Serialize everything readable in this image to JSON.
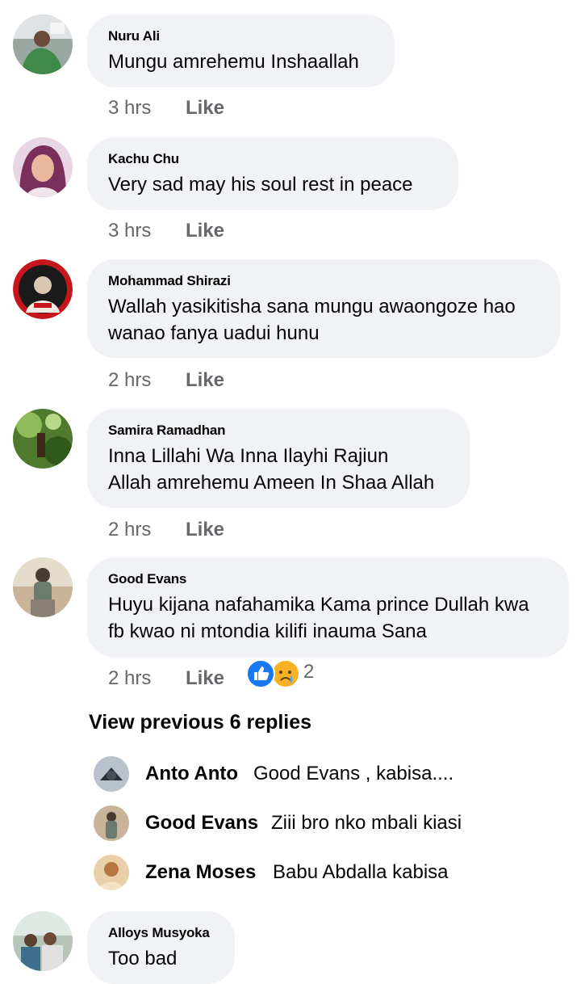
{
  "comments": [
    {
      "author": "Nuru Ali",
      "lines": [
        "Mungu amrehemu Inshaallah"
      ],
      "time": "3 hrs",
      "like": "Like"
    },
    {
      "author": "Kachu Chu",
      "lines": [
        "Very sad  may his soul rest in peace"
      ],
      "time": "3 hrs",
      "like": "Like"
    },
    {
      "author": "Mohammad Shirazi",
      "lines": [
        "Wallah yasikitisha sana mungu awaongoze hao",
        "wanao fanya uadui hunu"
      ],
      "time": "2 hrs",
      "like": "Like"
    },
    {
      "author": "Samira Ramadhan",
      "lines": [
        "Inna Lillahi Wa Inna Ilayhi Rajiun",
        "Allah amrehemu Ameen In Shaa Allah"
      ],
      "time": "2 hrs",
      "like": "Like"
    },
    {
      "author": "Good Evans",
      "lines": [
        "Huyu kijana nafahamika Kama prince Dullah kwa",
        "fb kwao ni mtondia kilifi inauma Sana"
      ],
      "time": "2 hrs",
      "like": "Like",
      "reaction_count": "2",
      "reaction_icons": [
        "like-reaction-icon",
        "sad-reaction-icon"
      ]
    },
    {
      "author": "Alloys Musyoka",
      "lines": [
        "Too bad"
      ]
    }
  ],
  "view_previous": "View previous 6 replies",
  "replies": [
    {
      "name": "Anto Anto",
      "text": "Good Evans , kabisa...."
    },
    {
      "name": "Good Evans",
      "text": "Ziii bro nko mbali kiasi"
    },
    {
      "name": "Zena Moses",
      "text": "Babu Abdalla kabisa"
    }
  ],
  "colors": {
    "bubble": "#f0f2f5",
    "meta": "#65676b",
    "like_blue": "#1877f2",
    "sad_yellow": "#f7b125"
  }
}
